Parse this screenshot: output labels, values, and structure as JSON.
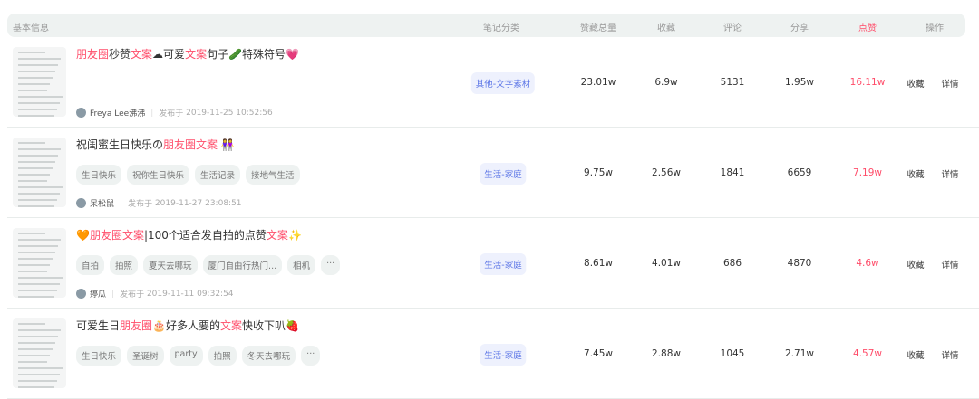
{
  "header": {
    "basic": "基本信息",
    "category": "笔记分类",
    "total": "赞藏总量",
    "collect": "收藏",
    "comment": "评论",
    "share": "分享",
    "like": "点赞",
    "action": "操作"
  },
  "colors": {
    "highlight": "#ff4d6a",
    "category": "#5a74e6",
    "header_bg": "#eef2f1"
  },
  "publish_prefix": "发布于",
  "actions": {
    "collect": "收藏",
    "detail": "详情"
  },
  "rows": [
    {
      "title": [
        {
          "t": "朋友圈",
          "hl": true
        },
        {
          "t": "秒赞",
          "hl": false
        },
        {
          "t": "文案",
          "hl": true
        },
        {
          "t": "☁可爱",
          "hl": false
        },
        {
          "t": "文案",
          "hl": true
        },
        {
          "t": "句子🥒特殊符号💗",
          "hl": false
        }
      ],
      "tags": [],
      "author": "Freya Lee沸沸",
      "time": "2019-11-25 10:52:56",
      "category": "其他-文字素材",
      "total": "23.01w",
      "collect": "6.9w",
      "comment": "5131",
      "share": "1.95w",
      "like": "16.11w"
    },
    {
      "title": [
        {
          "t": "祝闺蜜生日快乐の",
          "hl": false
        },
        {
          "t": "朋友圈文案",
          "hl": true
        },
        {
          "t": " 👭",
          "hl": false
        }
      ],
      "tags": [
        "生日快乐",
        "祝你生日快乐",
        "生活记录",
        "接地气生活"
      ],
      "author": "呆松鼠",
      "time": "2019-11-27 23:08:51",
      "category": "生活-家庭",
      "total": "9.75w",
      "collect": "2.56w",
      "comment": "1841",
      "share": "6659",
      "like": "7.19w"
    },
    {
      "title": [
        {
          "t": "🧡",
          "hl": false
        },
        {
          "t": "朋友圈文案",
          "hl": true
        },
        {
          "t": "|100个适合发自拍的点赞",
          "hl": false
        },
        {
          "t": "文案",
          "hl": true
        },
        {
          "t": "✨",
          "hl": false
        }
      ],
      "tags": [
        "自拍",
        "拍照",
        "夏天去哪玩",
        "厦门自由行热门...",
        "相机",
        "···"
      ],
      "author": "婷瓜",
      "time": "2019-11-11 09:32:54",
      "category": "生活-家庭",
      "total": "8.61w",
      "collect": "4.01w",
      "comment": "686",
      "share": "4870",
      "like": "4.6w"
    },
    {
      "title": [
        {
          "t": "可爱生日",
          "hl": false
        },
        {
          "t": "朋友圈",
          "hl": true
        },
        {
          "t": "🎂好多人要的",
          "hl": false
        },
        {
          "t": "文案",
          "hl": true
        },
        {
          "t": "快收下叭🍓",
          "hl": false
        }
      ],
      "tags": [
        "生日快乐",
        "圣诞树",
        "party",
        "拍照",
        "冬天去哪玩",
        "···"
      ],
      "author": "",
      "time": "",
      "category": "生活-家庭",
      "total": "7.45w",
      "collect": "2.88w",
      "comment": "1045",
      "share": "2.71w",
      "like": "4.57w"
    }
  ]
}
